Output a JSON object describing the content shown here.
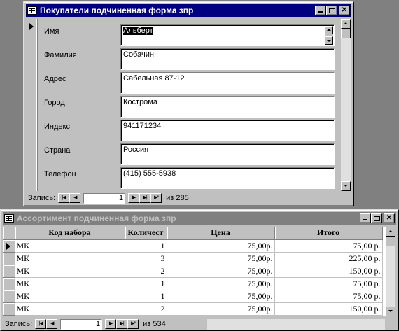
{
  "form1": {
    "title": "Покупатели подчиненная форма зпр",
    "fields": [
      {
        "label": "Имя",
        "value": "Альберт"
      },
      {
        "label": "Фамилия",
        "value": "Собачин"
      },
      {
        "label": "Адрес",
        "value": "Сабельная 87-12"
      },
      {
        "label": "Город",
        "value": "Кострома"
      },
      {
        "label": "Индекс",
        "value": "941171234"
      },
      {
        "label": "Страна",
        "value": "Россия"
      },
      {
        "label": "Телефон",
        "value": "(415) 555-5938"
      }
    ],
    "nav": {
      "label": "Запись:",
      "current": "1",
      "of": "из 285"
    }
  },
  "form2": {
    "title": "Ассортимент подчиненная форма зпр",
    "columns": [
      "Код набора",
      "Количест",
      "Цена",
      "Итого"
    ],
    "rows": [
      [
        "МК",
        "1",
        "75,00р.",
        "75,00 р."
      ],
      [
        "МК",
        "3",
        "75,00р.",
        "225,00 р."
      ],
      [
        "МК",
        "2",
        "75,00р.",
        "150,00 р."
      ],
      [
        "МК",
        "1",
        "75,00р.",
        "75,00 р."
      ],
      [
        "МК",
        "1",
        "75,00р.",
        "75,00 р."
      ],
      [
        "МК",
        "2",
        "75,00р.",
        "150,00 р."
      ]
    ],
    "nav": {
      "label": "Запись:",
      "current": "1",
      "of": "из 534"
    }
  }
}
